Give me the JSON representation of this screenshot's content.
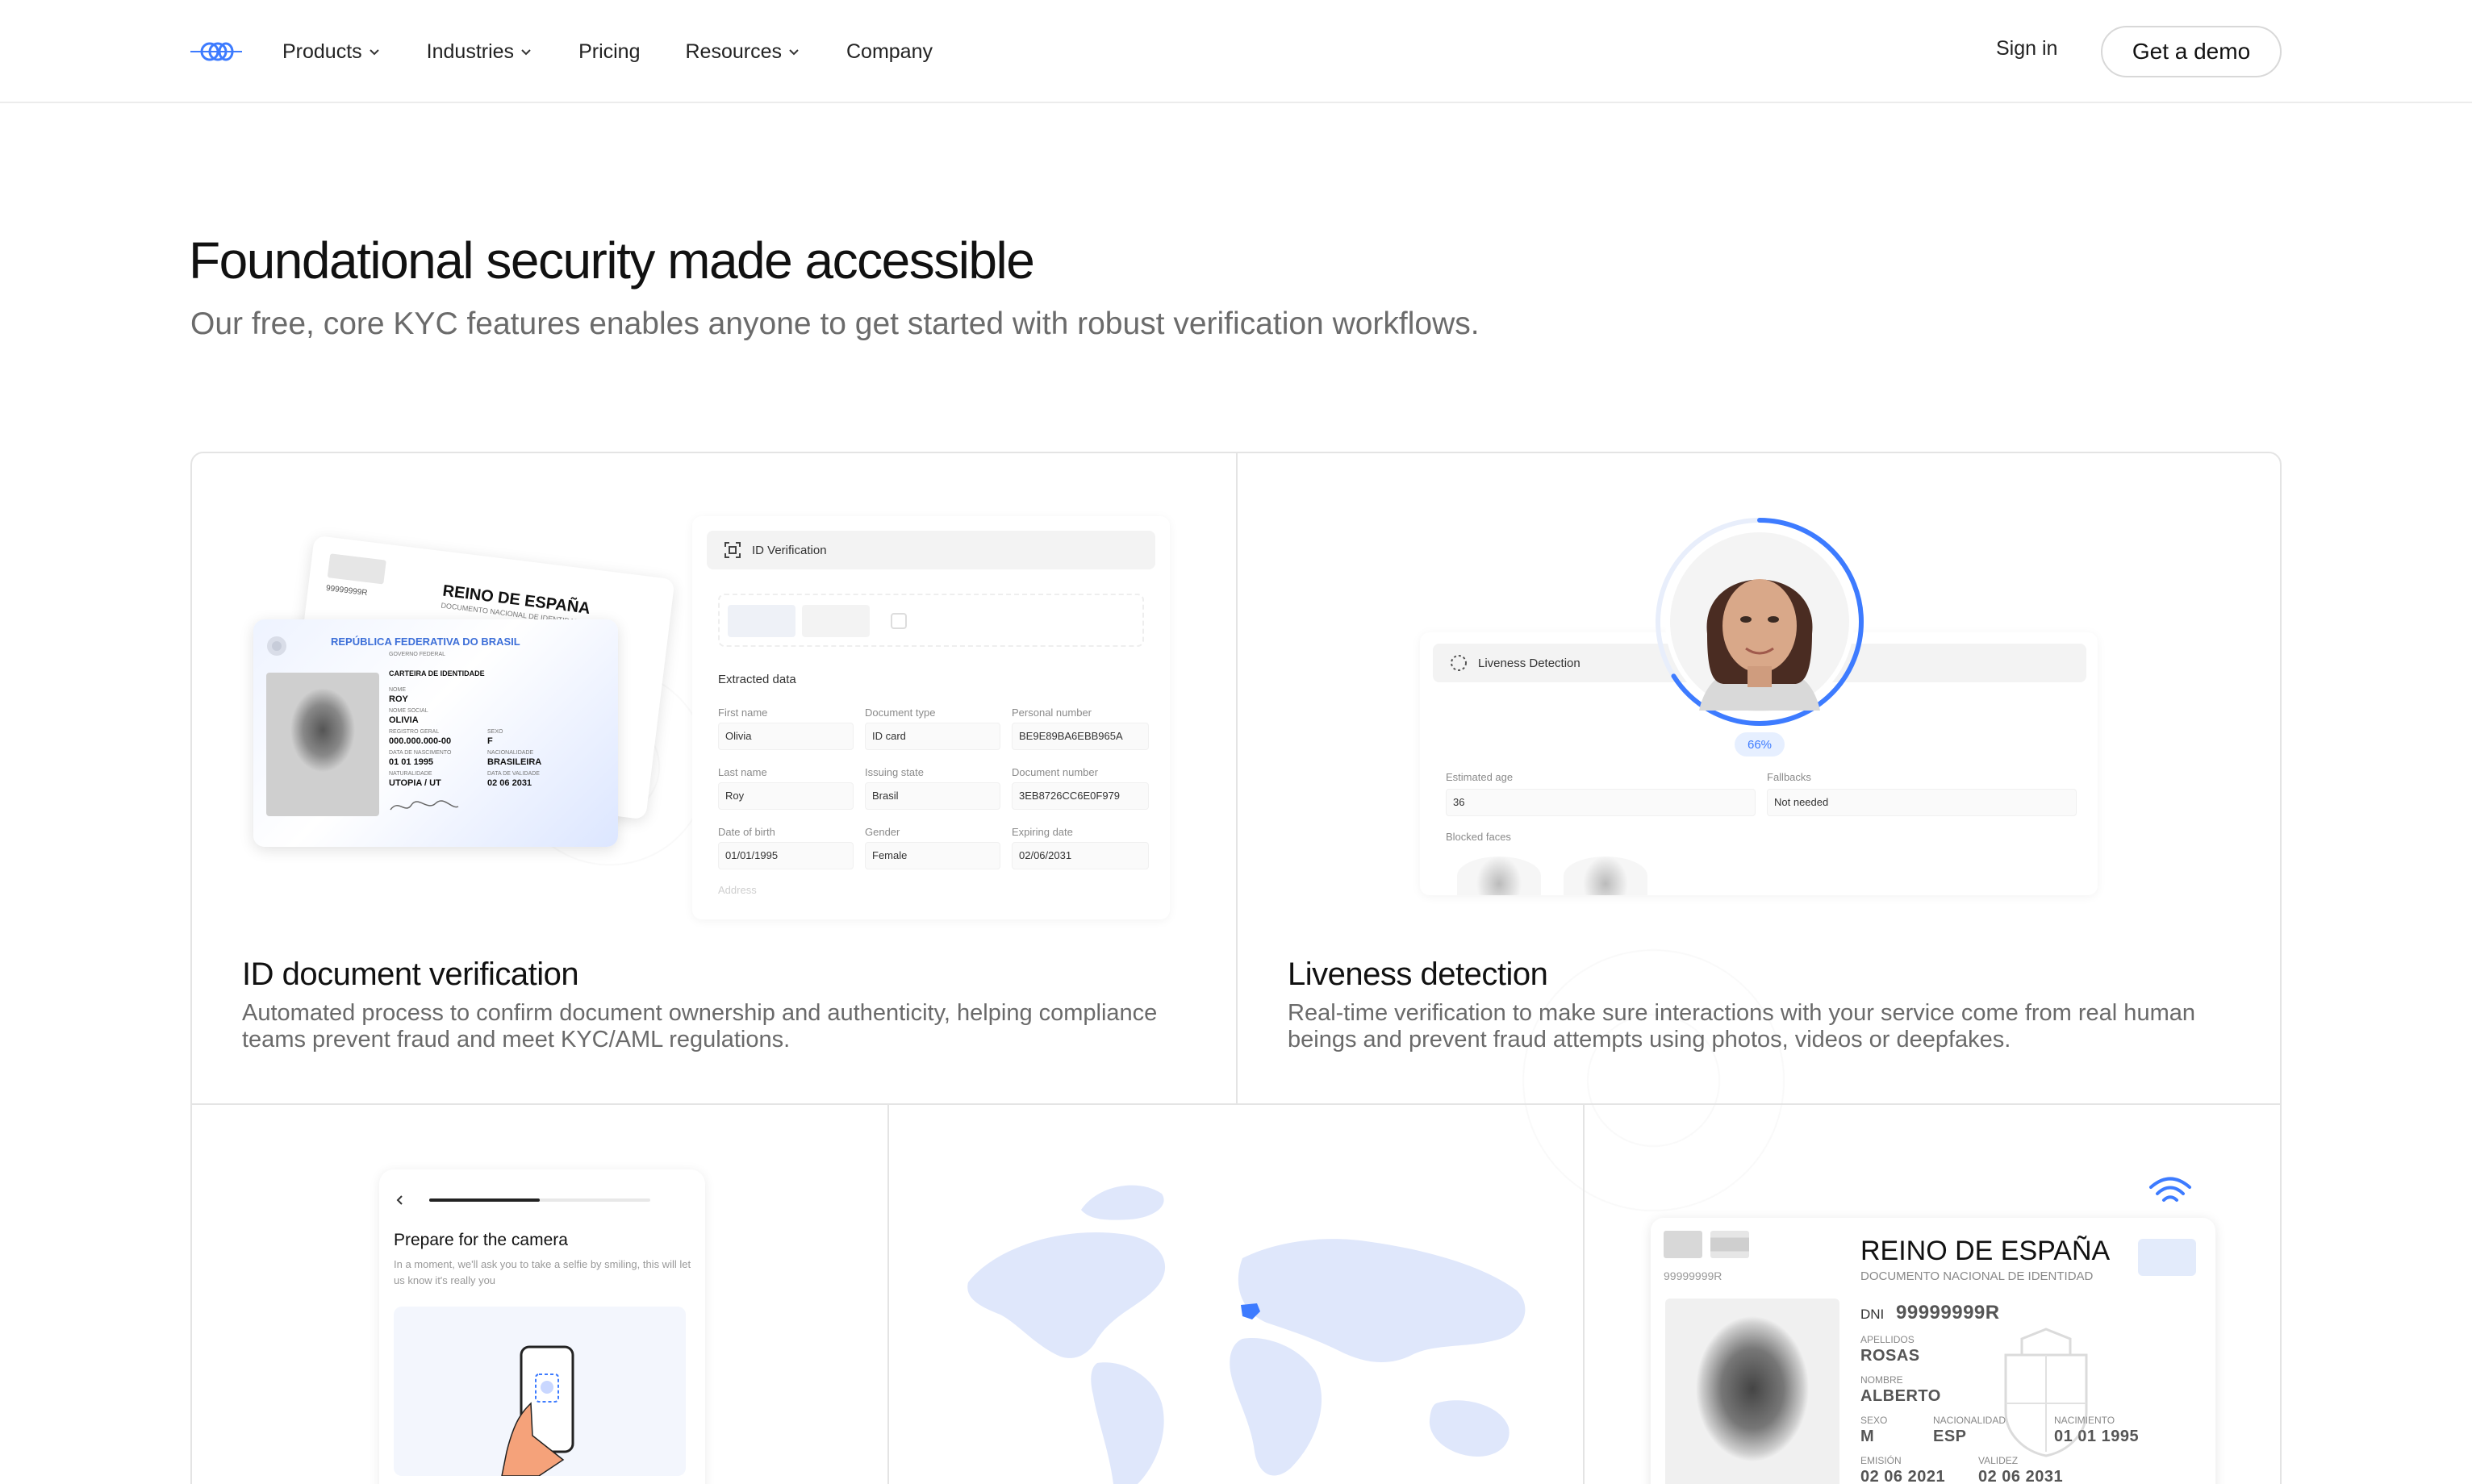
{
  "header": {
    "nav": [
      {
        "label": "Products",
        "has_menu": true
      },
      {
        "label": "Industries",
        "has_menu": true
      },
      {
        "label": "Pricing",
        "has_menu": false
      },
      {
        "label": "Resources",
        "has_menu": true
      },
      {
        "label": "Company",
        "has_menu": false
      }
    ],
    "sign_in": "Sign in",
    "demo": "Get a demo"
  },
  "hero": {
    "title": "Foundational security made accessible",
    "subtitle": "Our free, core KYC features enables anyone to get started with robust verification workflows."
  },
  "cards": {
    "id_doc": {
      "title": "ID document verification",
      "desc": "Automated process to confirm document ownership and authenticity, helping compliance teams prevent fraud and meet KYC/AML regulations.",
      "panel_title": "ID Verification",
      "extracted": "Extracted data",
      "fields": {
        "first_name_l": "First name",
        "first_name_v": "Olivia",
        "doc_type_l": "Document type",
        "doc_type_v": "ID card",
        "personal_l": "Personal number",
        "personal_v": "BE9E89BA6EBB965A",
        "last_name_l": "Last name",
        "last_name_v": "Roy",
        "issuing_l": "Issuing state",
        "issuing_v": "Brasil",
        "doc_num_l": "Document number",
        "doc_num_v": "3EB8726CC6E0F979",
        "dob_l": "Date of birth",
        "dob_v": "01/01/1995",
        "gender_l": "Gender",
        "gender_v": "Female",
        "exp_l": "Expiring date",
        "exp_v": "02/06/2031",
        "address_l": "Address"
      },
      "card_back": {
        "country": "REINO DE ESPAÑA",
        "sub": "DOCUMENTO NACIONAL DE IDENTIDAD",
        "num": "99999999R"
      },
      "card_front": {
        "country": "REPÚBLICA FEDERATIVA DO BRASIL",
        "gov": "GOVERNO FEDERAL",
        "type": "CARTEIRA DE IDENTIDADE",
        "nome_l": "NOME",
        "nome": "ROY",
        "social_l": "NOME SOCIAL",
        "social": "OLIVIA",
        "reg_l": "REGISTRO GERAL",
        "reg": "000.000.000-00",
        "sexo_l": "SEXO",
        "sexo": "F",
        "nasc_l": "DATA DE NASCIMENTO",
        "nasc": "01 01 1995",
        "nac_l": "NACIONALIDADE",
        "nac": "BRASILEIRA",
        "nat_l": "NATURALIDADE",
        "nat": "UTOPIA / UT",
        "val_l": "DATA DE VALIDADE",
        "val": "02 06 2031"
      }
    },
    "liveness": {
      "title": "Liveness detection",
      "desc": "Real-time verification to make sure interactions with your service come from real human beings and prevent fraud attempts using photos, videos or deepfakes.",
      "panel_title": "Liveness Detection",
      "pct": "66%",
      "progress": 0.66,
      "age_l": "Estimated age",
      "age_v": "36",
      "fallbacks_l": "Fallbacks",
      "fallbacks_v": "Not needed",
      "blocked_l": "Blocked faces"
    },
    "selfie": {
      "title": "Prepare for the camera",
      "desc": "In a moment, we'll ask you to take a selfie by smiling, this will let us know it's really you"
    },
    "nfc": {
      "country": "REINO DE ESPAÑA",
      "sub": "DOCUMENTO NACIONAL DE IDENTIDAD",
      "num": "99999999R",
      "dni_l": "DNI",
      "dni": "99999999R",
      "apellidos_l": "APELLIDOS",
      "apellidos": "ROSAS",
      "nombre_l": "NOMBRE",
      "nombre": "ALBERTO",
      "sexo_l": "SEXO",
      "sexo": "M",
      "nac_l": "NACIONALIDAD",
      "nac": "ESP",
      "naci_l": "NACIMIENTO",
      "naci": "01 01 1995",
      "emision_l": "EMISIÓN",
      "emision": "02 06 2021",
      "validez_l": "VALIDEZ",
      "validez": "02 06 2031"
    }
  },
  "colors": {
    "accent": "#3d7bff",
    "map": "#dfe7fb",
    "map_highlight": "#3d7bff"
  }
}
